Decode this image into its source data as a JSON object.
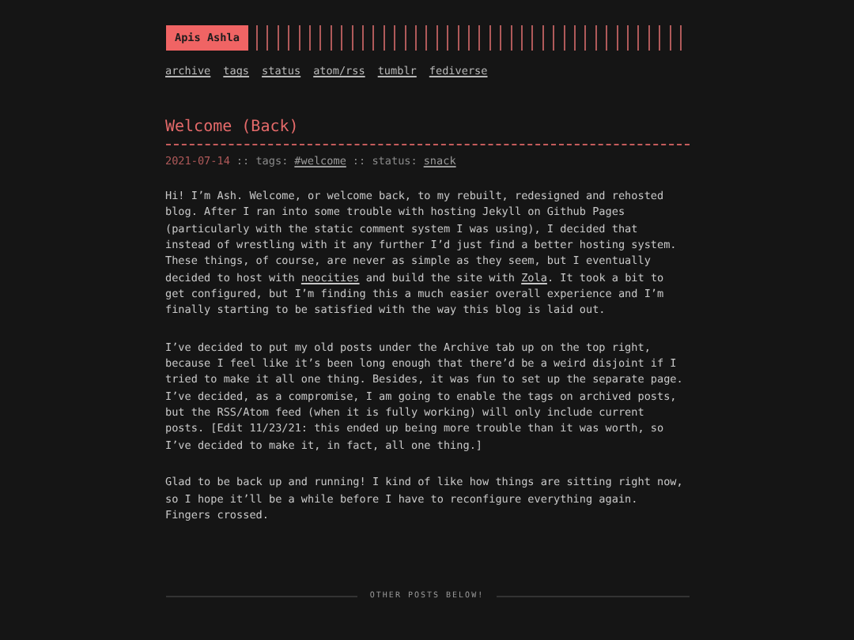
{
  "header": {
    "logo": "Apis Ashla",
    "nav": [
      "archive",
      "tags",
      "status",
      "atom/rss",
      "tumblr",
      "fediverse"
    ]
  },
  "post": {
    "title": "Welcome (Back)",
    "date": "2021-07-14",
    "tags_label": ":: tags:",
    "tags": [
      "#welcome"
    ],
    "status_label": ":: status:",
    "status": "snack",
    "paragraphs": [
      [
        {
          "kind": "text",
          "text": "Hi! I’m Ash. Welcome, or welcome back, to my rebuilt, redesigned and rehosted blog. After I ran into some trouble with hosting Jekyll on Github Pages (particularly with the static comment system I was using), I decided that instead of wrestling with it any further I’d just find a better hosting system. These things, of course, are never as simple as they seem, but I eventually decided to host with "
        },
        {
          "kind": "link",
          "text": "neocities"
        },
        {
          "kind": "text",
          "text": " and build the site with "
        },
        {
          "kind": "link",
          "text": "Zola"
        },
        {
          "kind": "text",
          "text": ". It took a bit to get configured, but I’m finding this a much easier overall experience and I’m finally starting to be satisfied with the way this blog is laid out."
        }
      ],
      [
        {
          "kind": "text",
          "text": "I’ve decided to put my old posts under the Archive tab up on the top right, because I feel like it’s been long enough that there’d be a weird disjoint if I tried to make it all one thing. Besides, it was fun to set up the separate page. I’ve decided, as a compromise, I am going to enable the tags on archived posts, but the RSS/Atom feed (when it is fully working) will only include current posts. [Edit 11/23/21: this ended up being more trouble than it was worth, so I’ve decided to make it, in fact, all one thing.]"
        }
      ],
      [
        {
          "kind": "text",
          "text": "Glad to be back up and running! I kind of like how things are sitting right now, so I hope it’ll be a while before I have to reconfigure everything again. Fingers crossed."
        }
      ]
    ]
  },
  "footer": {
    "divider_label": "OTHER POSTS BELOW!"
  }
}
